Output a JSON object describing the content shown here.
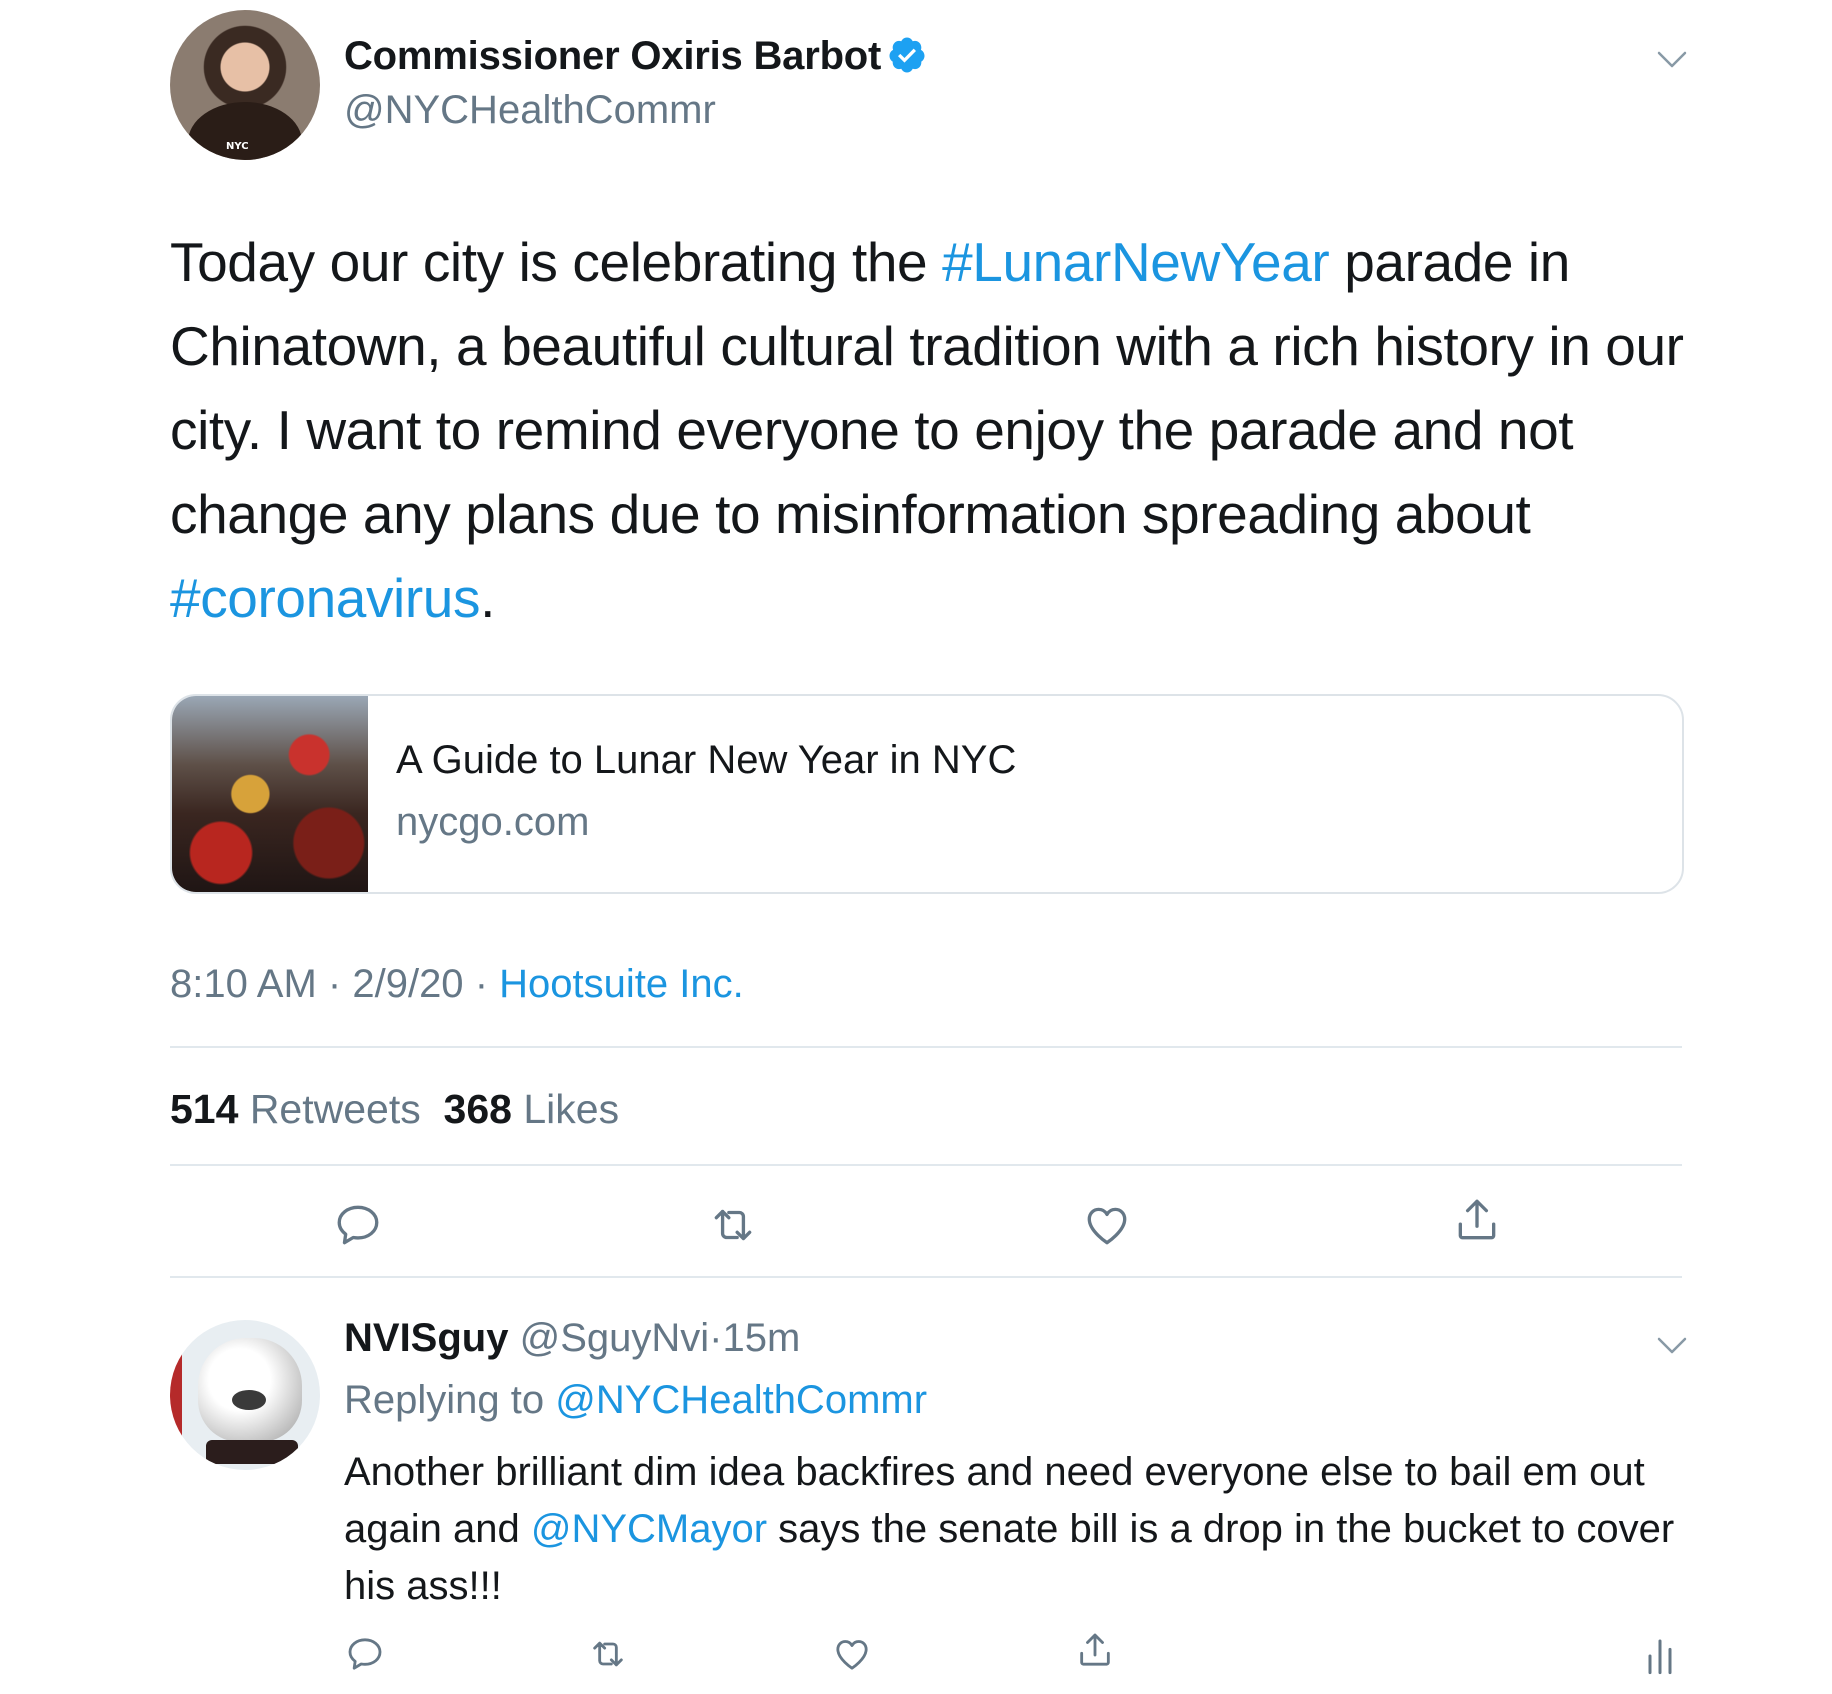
{
  "main_tweet": {
    "author_name": "Commissioner Oxiris Barbot",
    "author_handle": "@NYCHealthCommr",
    "avatar_badge": "NYC",
    "text_parts": [
      {
        "text": "Today our city is celebrating the ",
        "type": "text"
      },
      {
        "text": "#LunarNewYear",
        "type": "hashtag"
      },
      {
        "text": " parade in Chinatown, a beautiful cultural tradition with a rich history in our city. I want to remind everyone to enjoy the parade and not change any plans due to misinformation spreading about ",
        "type": "text"
      },
      {
        "text": "#coronavirus",
        "type": "hashtag"
      },
      {
        "text": ".",
        "type": "text"
      }
    ],
    "card": {
      "title": "A Guide to Lunar New Year in NYC",
      "domain": "nycgo.com"
    },
    "time": "8:10 AM",
    "date": "2/9/20",
    "source": "Hootsuite Inc.",
    "separator": "·",
    "retweets_count": "514",
    "retweets_label": "Retweets",
    "likes_count": "368",
    "likes_label": "Likes"
  },
  "reply": {
    "author_name": "NVISguy",
    "author_handle": "@SguyNvi",
    "age": "15m",
    "replying_prefix": "Replying to",
    "replying_to": "@NYCHealthCommr",
    "text_before": "Another brilliant dim idea backfires and need everyone else to bail em out again and ",
    "mention": "@NYCMayor",
    "text_after": " says the senate bill is a drop in the bucket to cover his ass!!!"
  },
  "icons": [
    "chevron-down-icon",
    "verified-badge-icon",
    "reply-icon",
    "retweet-icon",
    "like-icon",
    "share-icon",
    "analytics-icon"
  ],
  "colors": {
    "link": "#1b95e0",
    "muted": "#657786",
    "divider": "#e1e8ed"
  }
}
